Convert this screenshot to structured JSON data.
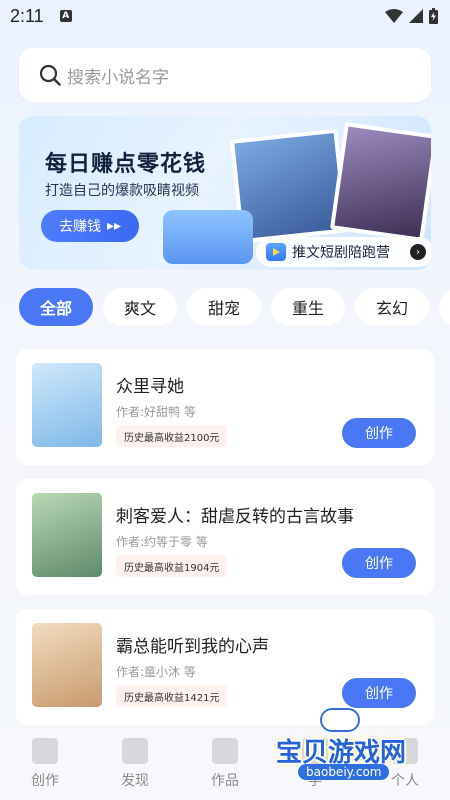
{
  "status_bar": {
    "time": "2:11",
    "a_badge": "A"
  },
  "search": {
    "placeholder": "搜索小说名字"
  },
  "banner": {
    "title": "每日赚点零花钱",
    "subtitle": "打造自己的爆款吸睛视频",
    "button_label": "去赚钱",
    "tag_label": "推文短剧陪跑营"
  },
  "tabs": [
    {
      "label": "全部",
      "active": true
    },
    {
      "label": "爽文"
    },
    {
      "label": "甜宠"
    },
    {
      "label": "重生"
    },
    {
      "label": "玄幻"
    }
  ],
  "novels": [
    {
      "title": "众里寻她",
      "author": "作者:好甜鸭 等",
      "earnings": "历史最高收益2100元",
      "button": "创作",
      "cover_color": "#a9d4f5"
    },
    {
      "title": "刺客爱人：甜虐反转的古言故事",
      "author": "作者:约等于零 等",
      "earnings": "历史最高收益1904元",
      "button": "创作",
      "cover_color": "#8bb79a"
    },
    {
      "title": "霸总能听到我的心声",
      "author": "作者:童小沐 等",
      "earnings": "历史最高收益1421元",
      "button": "创作",
      "cover_color": "#e8c9a0"
    }
  ],
  "bottom_nav": [
    {
      "label": "创作",
      "icon": "video-icon"
    },
    {
      "label": "发现",
      "icon": "cube-icon"
    },
    {
      "label": "作品",
      "icon": "play-file-icon"
    },
    {
      "label": "学",
      "icon": "book-icon"
    },
    {
      "label": "个人",
      "icon": "person-icon"
    }
  ],
  "watermark": {
    "text": "宝贝游戏网",
    "url": "baobeiy.com"
  },
  "colors": {
    "accent": "#4a78f5",
    "earn_bg": "#fff1ee"
  }
}
